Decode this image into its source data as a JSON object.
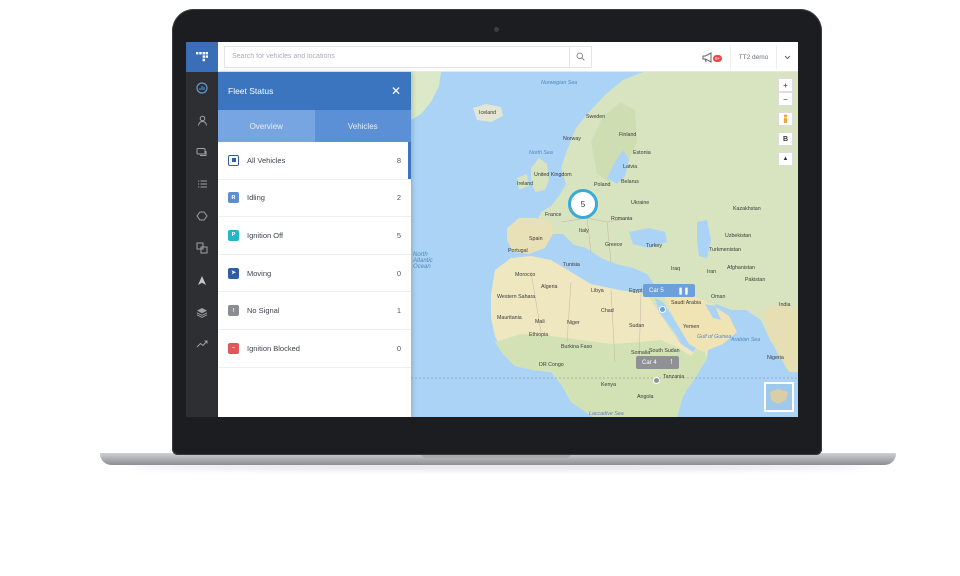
{
  "search": {
    "placeholder": "Search for vehicles and locations"
  },
  "topbar": {
    "account_label": "TT2 demo",
    "notification_badge": "9+"
  },
  "rail": {
    "items": [
      {
        "icon": "dashboard-icon"
      },
      {
        "icon": "person-icon"
      },
      {
        "icon": "chat-icon"
      },
      {
        "icon": "list-icon"
      },
      {
        "icon": "route-icon"
      },
      {
        "icon": "layers-icon"
      },
      {
        "icon": "navigation-icon"
      },
      {
        "icon": "stack-icon"
      },
      {
        "icon": "trend-icon"
      }
    ]
  },
  "panel": {
    "title": "Fleet Status",
    "tabs": [
      {
        "label": "Overview",
        "active": true
      },
      {
        "label": "Vehicles",
        "active": false
      }
    ],
    "statuses": [
      {
        "label": "All Vehicles",
        "count": "8",
        "color": "#2f5ea6",
        "symbol": "",
        "outlined": true
      },
      {
        "label": "Idling",
        "count": "2",
        "color": "#5d8fd0",
        "symbol": "R"
      },
      {
        "label": "Ignition Off",
        "count": "5",
        "color": "#26b6c9",
        "symbol": "P"
      },
      {
        "label": "Moving",
        "count": "0",
        "color": "#2f5ea6",
        "symbol": "➤"
      },
      {
        "label": "No Signal",
        "count": "1",
        "color": "#8a8d92",
        "symbol": "!"
      },
      {
        "label": "Ignition Blocked",
        "count": "0",
        "color": "#e15656",
        "symbol": "–"
      }
    ]
  },
  "map": {
    "cluster_count": "5",
    "car5_label": "Car 5",
    "car4_label": "Car 4",
    "controls": {
      "zoom_in": "+",
      "zoom_out": "−",
      "view_b": "B",
      "north": "▲"
    },
    "labels": [
      {
        "text": "Norwegian Sea",
        "sea": true
      },
      {
        "text": "Iceland"
      },
      {
        "text": "Sweden"
      },
      {
        "text": "Finland"
      },
      {
        "text": "Norway"
      },
      {
        "text": "North Sea",
        "sea": true
      },
      {
        "text": "Estonia"
      },
      {
        "text": "Latvia"
      },
      {
        "text": "Belarus"
      },
      {
        "text": "Poland"
      },
      {
        "text": "Ukraine"
      },
      {
        "text": "United Kingdom"
      },
      {
        "text": "Ireland"
      },
      {
        "text": "France"
      },
      {
        "text": "Romania"
      },
      {
        "text": "Kazakhstan"
      },
      {
        "text": "Spain"
      },
      {
        "text": "Italy"
      },
      {
        "text": "Portugal"
      },
      {
        "text": "Greece"
      },
      {
        "text": "Turkey"
      },
      {
        "text": "Turkmenistan"
      },
      {
        "text": "Uzbekistan"
      },
      {
        "text": "Afghanistan"
      },
      {
        "text": "Iraq"
      },
      {
        "text": "Iran"
      },
      {
        "text": "Pakistan"
      },
      {
        "text": "Morocco"
      },
      {
        "text": "Tunisia"
      },
      {
        "text": "Algeria"
      },
      {
        "text": "Libya"
      },
      {
        "text": "Egypt"
      },
      {
        "text": "Saudi Arabia"
      },
      {
        "text": "Oman"
      },
      {
        "text": "India"
      },
      {
        "text": "Western Sahara"
      },
      {
        "text": "Mauritania"
      },
      {
        "text": "Mali"
      },
      {
        "text": "Niger"
      },
      {
        "text": "Chad"
      },
      {
        "text": "Sudan"
      },
      {
        "text": "Yemen"
      },
      {
        "text": "Arabian Sea",
        "sea": true
      },
      {
        "text": "Nigeria"
      },
      {
        "text": "Burkina Faso"
      },
      {
        "text": "Ethiopia"
      },
      {
        "text": "South Sudan"
      },
      {
        "text": "Somalia"
      },
      {
        "text": "Gulf of Guinea",
        "sea": true
      },
      {
        "text": "DR Congo"
      },
      {
        "text": "Kenya"
      },
      {
        "text": "Tanzania"
      },
      {
        "text": "Angola"
      },
      {
        "text": "Laccadive Sea",
        "sea": true
      }
    ],
    "ocean_label": "North\nAtlantic\nOcean"
  }
}
